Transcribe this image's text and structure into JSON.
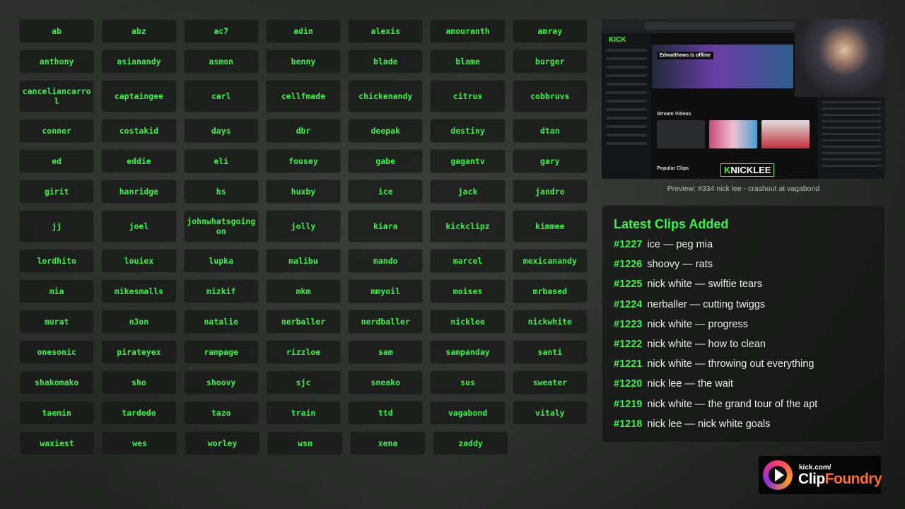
{
  "names": [
    [
      "ab",
      "abz",
      "ac7",
      "adin",
      "alexis",
      "amouranth",
      "amray"
    ],
    [
      "anthony",
      "asianandy",
      "asmon",
      "benny",
      "blade",
      "blame",
      "burger"
    ],
    [
      "canceliancarrol",
      "captaingee",
      "carl",
      "cellfmade",
      "chickenandy",
      "citrus",
      "cobbruvs"
    ],
    [
      "conner",
      "costakid",
      "days",
      "dbr",
      "deepak",
      "destiny",
      "dtan"
    ],
    [
      "ed",
      "eddie",
      "eli",
      "fousey",
      "gabe",
      "gagantv",
      "gary"
    ],
    [
      "girit",
      "hanridge",
      "hs",
      "huxby",
      "ice",
      "jack",
      "jandro"
    ],
    [
      "jj",
      "joel",
      "johnwhatsgoingon",
      "jolly",
      "kiara",
      "kickclipz",
      "kimmee"
    ],
    [
      "lordhito",
      "louiex",
      "lupka",
      "malibu",
      "mando",
      "marcel",
      "mexicanandy"
    ],
    [
      "mia",
      "mikesmalls",
      "mizkif",
      "mkm",
      "mmyoil",
      "moises",
      "mrbased"
    ],
    [
      "murat",
      "n3on",
      "natalie",
      "nerballer",
      "nerdballer",
      "nicklee",
      "nickwhite"
    ],
    [
      "onesonic",
      "pirateyex",
      "rampage",
      "rizzloe",
      "sam",
      "sampanday",
      "santi"
    ],
    [
      "shakomako",
      "sho",
      "shoovy",
      "sjc",
      "sneako",
      "sus",
      "sweater"
    ],
    [
      "taemin",
      "tardedo",
      "tazo",
      "train",
      "ttd",
      "vagabond",
      "vitaly"
    ],
    [
      "waxiest",
      "wes",
      "worley",
      "wsm",
      "xena",
      "zaddy"
    ]
  ],
  "preview": {
    "caption": "Preview: #334 nick lee - crashout at vagabond",
    "kick_logo": "KICK",
    "offline_text": "Edmatthews is offline",
    "stream_videos": "Stream Videos",
    "popular_clips": "Popular Clips",
    "overlay_logo": "NICKLEE"
  },
  "latest": {
    "title": "Latest Clips Added",
    "clips": [
      {
        "num": "#1227",
        "text": "ice — peg mia"
      },
      {
        "num": "#1226",
        "text": "shoovy — rats"
      },
      {
        "num": "#1225",
        "text": "nick white — swiftie tears"
      },
      {
        "num": "#1224",
        "text": "nerballer — cutting twiggs"
      },
      {
        "num": "#1223",
        "text": "nick white — progress"
      },
      {
        "num": "#1222",
        "text": "nick white — how to clean"
      },
      {
        "num": "#1221",
        "text": "nick white — throwing out everything"
      },
      {
        "num": "#1220",
        "text": "nick lee — the wait"
      },
      {
        "num": "#1219",
        "text": "nick white — the grand tour of the apt"
      },
      {
        "num": "#1218",
        "text": "nick lee — nick white goals"
      }
    ]
  },
  "brand": {
    "small": "kick.com/",
    "big_a": "Clip",
    "big_b": "Foundry"
  },
  "colors": {
    "accent": "#3cf24a",
    "kick_green": "#53fc18"
  }
}
